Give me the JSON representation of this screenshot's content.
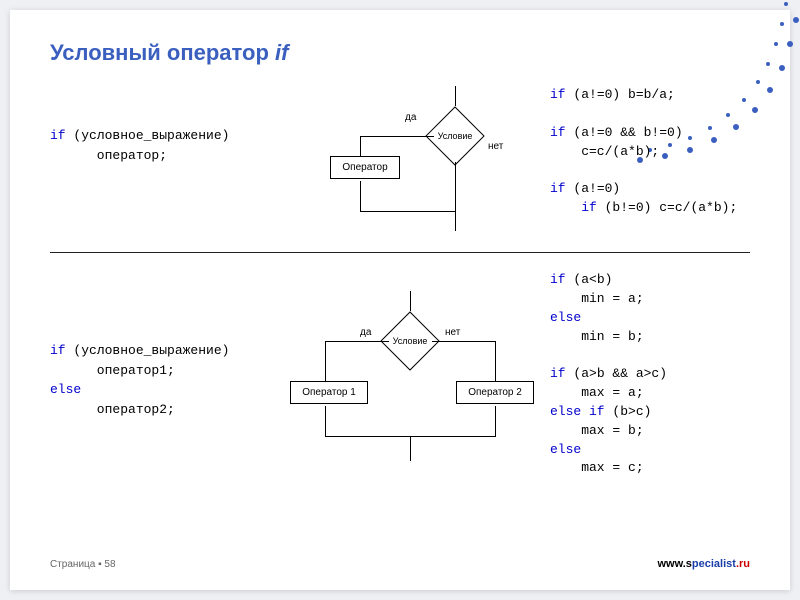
{
  "title_prefix": "Условный оператор ",
  "title_italic": "if",
  "syntax1_if": "if",
  "syntax1_rest": " (условное_выражение)\n      оператор;",
  "syntax2_if": "if",
  "syntax2_rest1": " (условное_выражение)\n      оператор1;",
  "syntax2_else": "else",
  "syntax2_rest2": "\n      оператор2;",
  "diagram": {
    "condition": "Условие",
    "operator": "Оператор",
    "yes": "да",
    "no": "нет",
    "op1": "Оператор 1",
    "op2": "Оператор 2"
  },
  "ex1_l1_kw": "if",
  "ex1_l1_rest": " (a!=0) b=b/a;",
  "ex1_l2_kw": "if",
  "ex1_l2_rest": " (a!=0 && b!=0)\n    c=c/(a*b);",
  "ex1_l3_kw": "if",
  "ex1_l3_rest": " (a!=0)\n    ",
  "ex1_l3b_kw": "if",
  "ex1_l3b_rest": " (b!=0) c=c/(a*b);",
  "ex2_l1_kw": "if",
  "ex2_l1_rest": " (a<b)\n    min = a;",
  "ex2_l1_else": "else",
  "ex2_l1_rest2": "\n    min = b;",
  "ex2_l2_kw": "if",
  "ex2_l2_rest": " (a>b && a>c)\n    max = a;",
  "ex2_l2_elseif": "else if",
  "ex2_l2_rest2": " (b>c)\n    max = b;",
  "ex2_l2_else": "else",
  "ex2_l2_rest3": "\n    max = c;",
  "footer_page": "Страница ▪ 58",
  "footer_brand_prefix": "www.s",
  "footer_brand_main": "pecialist",
  "footer_brand_suffix": ".ru"
}
